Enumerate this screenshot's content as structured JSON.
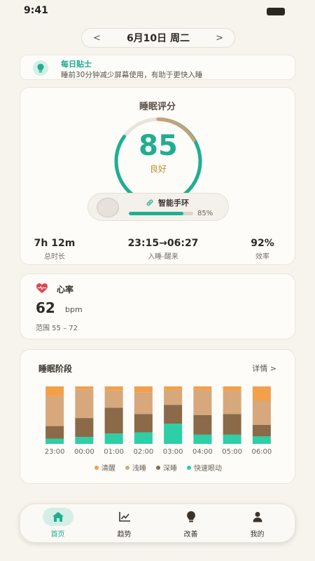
{
  "status": {
    "time": "9:41"
  },
  "date_nav": {
    "prev": "<",
    "date": "6月10日 周二",
    "next": ">"
  },
  "tip": {
    "title": "每日贴士",
    "text": "睡前30分钟减少屏幕使用，有助于更快入睡"
  },
  "score": {
    "title": "睡眠评分",
    "value": "85",
    "grade": "良好",
    "ring_fraction": 0.85,
    "device": {
      "name": "智能手环",
      "battery_label": "85%",
      "battery_fraction": 0.85
    },
    "stats": [
      {
        "value": "7h 12m",
        "label": "总时长"
      },
      {
        "value": "23:15→06:27",
        "label": "入睡-醒来"
      },
      {
        "value": "92%",
        "label": "效率"
      }
    ]
  },
  "heart": {
    "title": "心率",
    "value": "62",
    "unit": "bpm",
    "range": "范围 55 – 72"
  },
  "stages": {
    "title": "睡眠阶段",
    "more": "详情 >",
    "legend": [
      {
        "label": "清醒",
        "color": "#f2a04a"
      },
      {
        "label": "浅睡",
        "color": "#d6a87c"
      },
      {
        "label": "深睡",
        "color": "#8a6a48"
      },
      {
        "label": "快速眼动",
        "color": "#2ccfa6"
      }
    ]
  },
  "chart_data": {
    "type": "bar",
    "stacked": true,
    "categories": [
      "23:00",
      "00:00",
      "01:00",
      "02:00",
      "03:00",
      "04:00",
      "05:00",
      "06:00"
    ],
    "series": [
      {
        "name": "快速眼动",
        "color": "#2ccfa6",
        "values": [
          0.09,
          0.12,
          0.18,
          0.2,
          0.35,
          0.16,
          0.16,
          0.13
        ]
      },
      {
        "name": "深睡",
        "color": "#8a6a48",
        "values": [
          0.22,
          0.33,
          0.45,
          0.32,
          0.33,
          0.34,
          0.36,
          0.2
        ]
      },
      {
        "name": "浅睡",
        "color": "#d6a87c",
        "values": [
          0.52,
          0.5,
          0.3,
          0.38,
          0.26,
          0.44,
          0.4,
          0.42
        ]
      },
      {
        "name": "清醒",
        "color": "#f2a04a",
        "values": [
          0.17,
          0.05,
          0.07,
          0.1,
          0.06,
          0.06,
          0.08,
          0.25
        ]
      }
    ],
    "ylim": [
      0,
      1
    ],
    "grid": false,
    "legend": "bottom"
  },
  "tabs": [
    {
      "label": "首页",
      "icon": "home-icon",
      "active": true
    },
    {
      "label": "趋势",
      "icon": "trend-icon",
      "active": false
    },
    {
      "label": "改善",
      "icon": "bulb-icon",
      "active": false
    },
    {
      "label": "我的",
      "icon": "user-icon",
      "active": false
    }
  ],
  "colors": {
    "accent": "#1fae90",
    "grade": "#c78a35",
    "heart": "#e0484f"
  }
}
